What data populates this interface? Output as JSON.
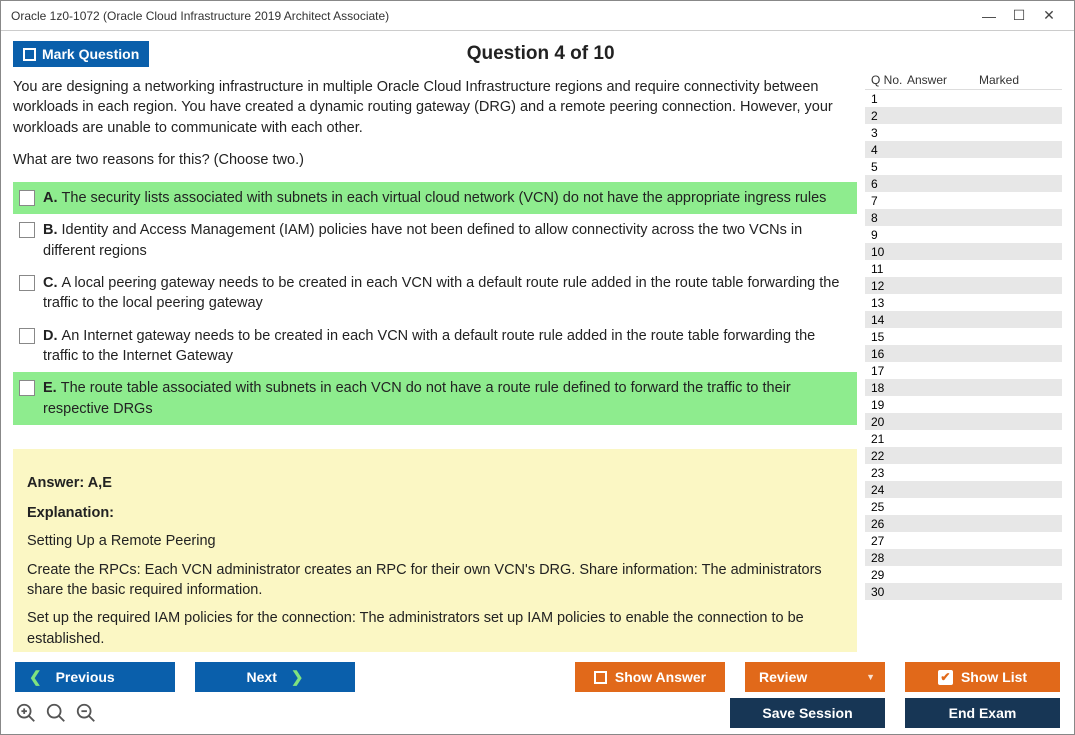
{
  "window": {
    "title": "Oracle 1z0-1072 (Oracle Cloud Infrastructure 2019 Architect Associate)"
  },
  "header": {
    "mark_label": "Mark Question",
    "question_label": "Question 4 of 10"
  },
  "question": {
    "body": "You are designing a networking infrastructure in multiple Oracle Cloud Infrastructure regions and require connectivity between workloads in each region. You have created a dynamic routing gateway (DRG) and a remote peering connection. However, your workloads are unable to communicate with each other.",
    "prompt": "What are two reasons for this? (Choose two.)",
    "options": [
      {
        "letter": "A.",
        "text": "The security lists associated with subnets in each virtual cloud network (VCN) do not have the appropriate ingress rules",
        "correct": true
      },
      {
        "letter": "B.",
        "text": "Identity and Access Management (IAM) policies have not been defined to allow connectivity across the two VCNs in different regions",
        "correct": false
      },
      {
        "letter": "C.",
        "text": "A local peering gateway needs to be created in each VCN with a default route rule added in the route table forwarding the traffic to the local peering gateway",
        "correct": false
      },
      {
        "letter": "D.",
        "text": "An Internet gateway needs to be created in each VCN with a default route rule added in the route table forwarding the traffic to the Internet Gateway",
        "correct": false
      },
      {
        "letter": "E.",
        "text": "The route table associated with subnets in each VCN do not have a route rule defined to forward the traffic to their respective DRGs",
        "correct": true
      }
    ]
  },
  "explanation": {
    "answer_line": "Answer: A,E",
    "label": "Explanation:",
    "p1": "Setting Up a Remote Peering",
    "p2": "Create the RPCs: Each VCN administrator creates an RPC for their own VCN's DRG. Share information: The administrators share the basic required information.",
    "p3": "Set up the required IAM policies for the connection: The administrators set up IAM policies to enable the connection to be established."
  },
  "side": {
    "h1": "Q No.",
    "h2": "Answer",
    "h3": "Marked",
    "count": 30
  },
  "buttons": {
    "previous": "Previous",
    "next": "Next",
    "show_answer": "Show Answer",
    "review": "Review",
    "show_list": "Show List",
    "save_session": "Save Session",
    "end_exam": "End Exam"
  }
}
